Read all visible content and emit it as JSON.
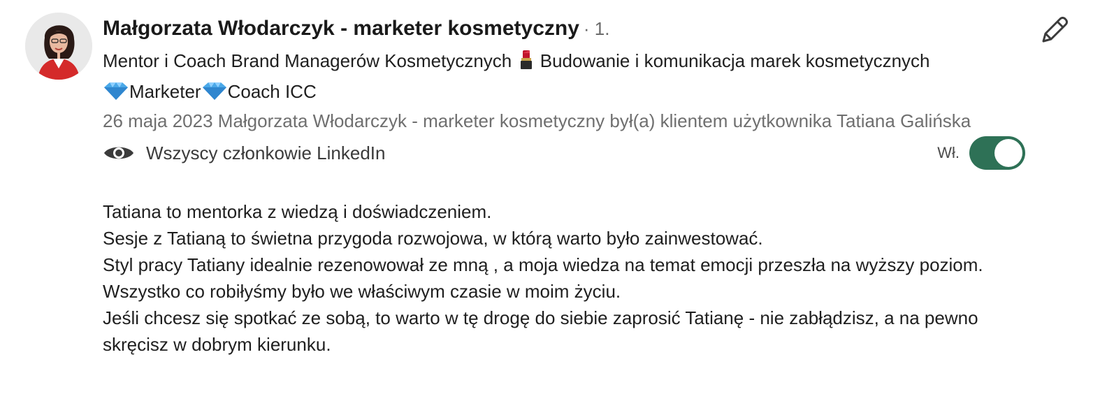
{
  "recommendation": {
    "author": {
      "name": "Małgorzata Włodarczyk - marketer kosmetyczny",
      "degree": "· 1.",
      "headline_part1": "Mentor i Coach Brand Managerów Kosmetycznych ",
      "headline_part2": " Budowanie i komunikacja marek kosmetycznych",
      "headline_part3": "Marketer",
      "headline_part4": "Coach ICC",
      "headline_icons": [
        "lipstick-icon",
        "gem-icon"
      ]
    },
    "meta": "26 maja 2023 Małgorzata Włodarczyk - marketer kosmetyczny był(a) klientem użytkownika Tatiana Galińska",
    "visibility": {
      "icon": "eye-icon",
      "label": "Wszyscy członkowie LinkedIn"
    },
    "toggle": {
      "label": "Wł.",
      "state": "on",
      "color": "#2e7156"
    },
    "body": [
      "Tatiana to mentorka z wiedzą i doświadczeniem.",
      "Sesje z Tatianą to świetna przygoda rozwojowa, w którą warto było zainwestować.",
      "Styl pracy Tatiany idealnie rezenowował ze mną , a moja wiedza na temat emocji przeszła na wyższy poziom.",
      "Wszystko co robiłyśmy było we właściwym czasie w moim życiu.",
      "Jeśli chcesz się spotkać ze sobą, to warto w tę drogę do siebie zaprosić Tatianę - nie zabłądzisz, a na pewno skręcisz w dobrym kierunku."
    ],
    "edit_icon": "pencil-icon"
  }
}
